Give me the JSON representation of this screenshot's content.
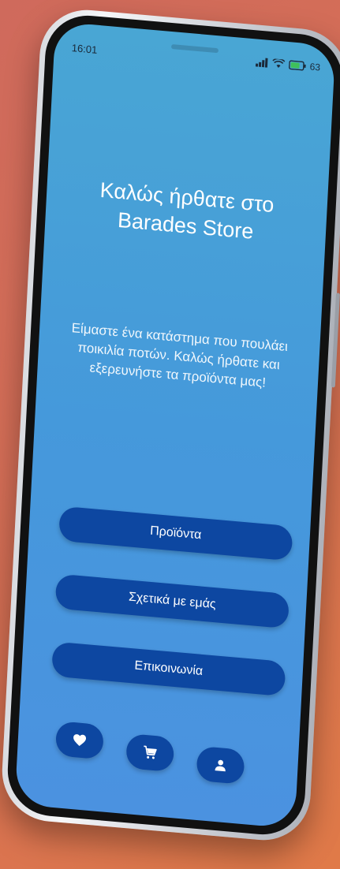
{
  "status_bar": {
    "time": "16:01",
    "battery": "63"
  },
  "home": {
    "title_line1": "Καλώς ήρθατε στο",
    "title_line2": "Barades Store",
    "description": "Είμαστε ένα κατάστημα που πουλάει ποικιλία ποτών. Καλώς ήρθατε και εξερευνήστε τα προϊόντα μας!"
  },
  "menu": {
    "products_label": "Προϊόντα",
    "about_label": "Σχετικά με εμάς",
    "contact_label": "Επικοινωνία"
  },
  "icons": {
    "favorites": "heart-icon",
    "cart": "cart-icon",
    "profile": "person-icon"
  },
  "colors": {
    "button": "#0d47a1",
    "screen_top": "#49a6d4",
    "screen_bottom": "#4b92e0",
    "background": "#d66f56"
  }
}
